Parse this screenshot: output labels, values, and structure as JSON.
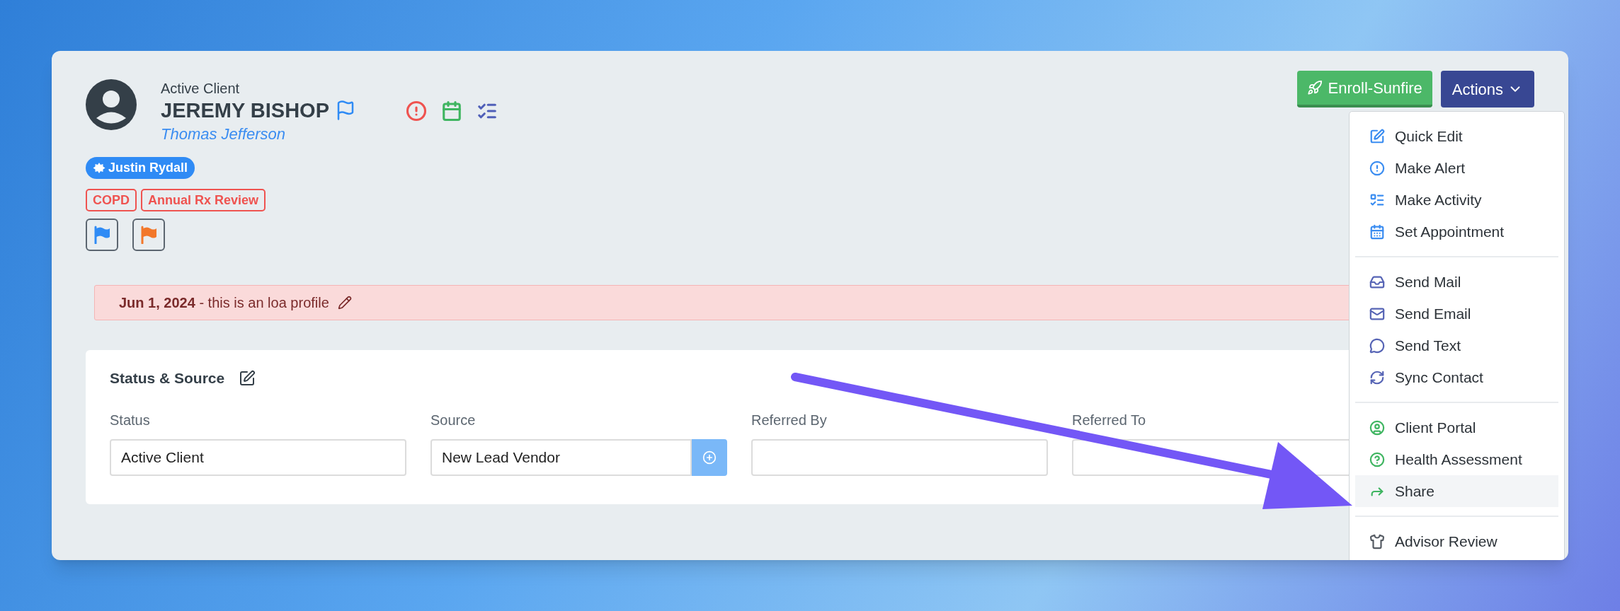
{
  "client": {
    "status": "Active Client",
    "name": "JEREMY BISHOP",
    "subtitle": "Thomas Jefferson"
  },
  "agent_badge": "Justin Rydall",
  "tags": [
    {
      "label": "COPD"
    },
    {
      "label": "Annual Rx Review"
    }
  ],
  "flags": [
    {
      "color": "#2f8bf5"
    },
    {
      "color": "#f2772a"
    }
  ],
  "header_buttons": [
    {
      "label": "Enroll-Sunfire",
      "kind": "enroll"
    },
    {
      "label": "Actions",
      "kind": "dropdown"
    }
  ],
  "note": {
    "text": "**Jun 1, 2024** - this is an loa profile"
  },
  "status_source": {
    "title": "Status & Source",
    "fields": [
      {
        "label": "Status",
        "value": "Active Client",
        "kind": "text"
      },
      {
        "label": "Source",
        "value": "New Lead Vendor",
        "kind": "addon"
      },
      {
        "label": "Referred By",
        "kind": "text"
      },
      {
        "label": "Referred To",
        "kind": "text"
      }
    ]
  },
  "actions_menu": {
    "groups": [
      [
        {
          "label": "Quick Edit",
          "selected": false
        },
        {
          "label": "Make Alert",
          "selected": false
        },
        {
          "label": "Make Activity",
          "selected": false
        },
        {
          "label": "Set Appointment",
          "selected": false
        }
      ],
      [
        {
          "label": "Send Mail",
          "selected": false
        },
        {
          "label": "Send Email",
          "selected": false
        },
        {
          "label": "Send Text",
          "selected": false
        },
        {
          "label": "Sync Contact",
          "selected": false
        }
      ],
      [
        {
          "label": "Client Portal",
          "selected": false
        },
        {
          "label": "Health Assessment",
          "selected": false
        },
        {
          "label": "Share",
          "selected": true
        }
      ],
      [
        {
          "label": "Advisor Review",
          "selected": false
        }
      ]
    ]
  }
}
